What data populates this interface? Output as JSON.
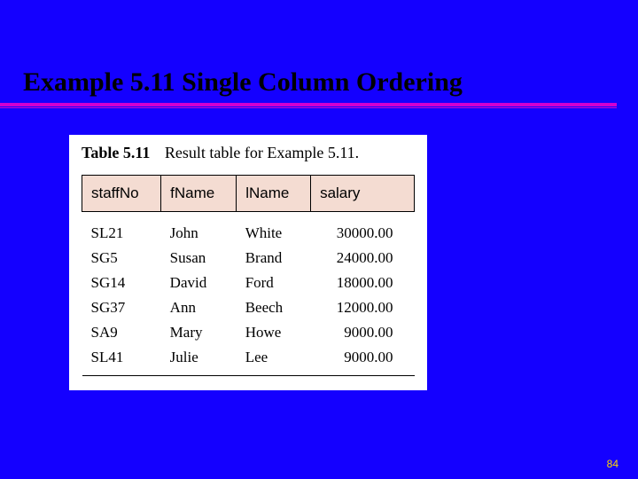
{
  "slide": {
    "heading": "Example 5.11  Single Column Ordering",
    "page_number": "84"
  },
  "table": {
    "label": "Table 5.11",
    "description": "Result table for Example 5.11.",
    "columns": [
      "staffNo",
      "fName",
      "lName",
      "salary"
    ],
    "rows": [
      {
        "staffNo": "SL21",
        "fName": "John",
        "lName": "White",
        "salary": "30000.00"
      },
      {
        "staffNo": "SG5",
        "fName": "Susan",
        "lName": "Brand",
        "salary": "24000.00"
      },
      {
        "staffNo": "SG14",
        "fName": "David",
        "lName": "Ford",
        "salary": "18000.00"
      },
      {
        "staffNo": "SG37",
        "fName": "Ann",
        "lName": "Beech",
        "salary": "12000.00"
      },
      {
        "staffNo": "SA9",
        "fName": "Mary",
        "lName": "Howe",
        "salary": "9000.00"
      },
      {
        "staffNo": "SL41",
        "fName": "Julie",
        "lName": "Lee",
        "salary": "9000.00"
      }
    ]
  },
  "chart_data": {
    "type": "table",
    "title": "Table 5.11 Result table for Example 5.11.",
    "columns": [
      "staffNo",
      "fName",
      "lName",
      "salary"
    ],
    "rows": [
      [
        "SL21",
        "John",
        "White",
        30000.0
      ],
      [
        "SG5",
        "Susan",
        "Brand",
        24000.0
      ],
      [
        "SG14",
        "David",
        "Ford",
        18000.0
      ],
      [
        "SG37",
        "Ann",
        "Beech",
        12000.0
      ],
      [
        "SA9",
        "Mary",
        "Howe",
        9000.0
      ],
      [
        "SL41",
        "Julie",
        "Lee",
        9000.0
      ]
    ]
  }
}
